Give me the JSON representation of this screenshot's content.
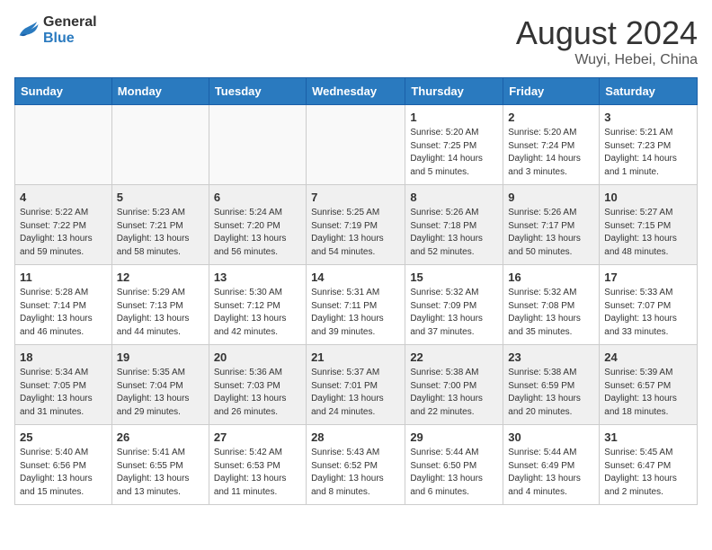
{
  "header": {
    "logo_general": "General",
    "logo_blue": "Blue",
    "month_year": "August 2024",
    "location": "Wuyi, Hebei, China"
  },
  "weekdays": [
    "Sunday",
    "Monday",
    "Tuesday",
    "Wednesday",
    "Thursday",
    "Friday",
    "Saturday"
  ],
  "weeks": [
    [
      {
        "num": "",
        "info": ""
      },
      {
        "num": "",
        "info": ""
      },
      {
        "num": "",
        "info": ""
      },
      {
        "num": "",
        "info": ""
      },
      {
        "num": "1",
        "info": "Sunrise: 5:20 AM\nSunset: 7:25 PM\nDaylight: 14 hours\nand 5 minutes."
      },
      {
        "num": "2",
        "info": "Sunrise: 5:20 AM\nSunset: 7:24 PM\nDaylight: 14 hours\nand 3 minutes."
      },
      {
        "num": "3",
        "info": "Sunrise: 5:21 AM\nSunset: 7:23 PM\nDaylight: 14 hours\nand 1 minute."
      }
    ],
    [
      {
        "num": "4",
        "info": "Sunrise: 5:22 AM\nSunset: 7:22 PM\nDaylight: 13 hours\nand 59 minutes."
      },
      {
        "num": "5",
        "info": "Sunrise: 5:23 AM\nSunset: 7:21 PM\nDaylight: 13 hours\nand 58 minutes."
      },
      {
        "num": "6",
        "info": "Sunrise: 5:24 AM\nSunset: 7:20 PM\nDaylight: 13 hours\nand 56 minutes."
      },
      {
        "num": "7",
        "info": "Sunrise: 5:25 AM\nSunset: 7:19 PM\nDaylight: 13 hours\nand 54 minutes."
      },
      {
        "num": "8",
        "info": "Sunrise: 5:26 AM\nSunset: 7:18 PM\nDaylight: 13 hours\nand 52 minutes."
      },
      {
        "num": "9",
        "info": "Sunrise: 5:26 AM\nSunset: 7:17 PM\nDaylight: 13 hours\nand 50 minutes."
      },
      {
        "num": "10",
        "info": "Sunrise: 5:27 AM\nSunset: 7:15 PM\nDaylight: 13 hours\nand 48 minutes."
      }
    ],
    [
      {
        "num": "11",
        "info": "Sunrise: 5:28 AM\nSunset: 7:14 PM\nDaylight: 13 hours\nand 46 minutes."
      },
      {
        "num": "12",
        "info": "Sunrise: 5:29 AM\nSunset: 7:13 PM\nDaylight: 13 hours\nand 44 minutes."
      },
      {
        "num": "13",
        "info": "Sunrise: 5:30 AM\nSunset: 7:12 PM\nDaylight: 13 hours\nand 42 minutes."
      },
      {
        "num": "14",
        "info": "Sunrise: 5:31 AM\nSunset: 7:11 PM\nDaylight: 13 hours\nand 39 minutes."
      },
      {
        "num": "15",
        "info": "Sunrise: 5:32 AM\nSunset: 7:09 PM\nDaylight: 13 hours\nand 37 minutes."
      },
      {
        "num": "16",
        "info": "Sunrise: 5:32 AM\nSunset: 7:08 PM\nDaylight: 13 hours\nand 35 minutes."
      },
      {
        "num": "17",
        "info": "Sunrise: 5:33 AM\nSunset: 7:07 PM\nDaylight: 13 hours\nand 33 minutes."
      }
    ],
    [
      {
        "num": "18",
        "info": "Sunrise: 5:34 AM\nSunset: 7:05 PM\nDaylight: 13 hours\nand 31 minutes."
      },
      {
        "num": "19",
        "info": "Sunrise: 5:35 AM\nSunset: 7:04 PM\nDaylight: 13 hours\nand 29 minutes."
      },
      {
        "num": "20",
        "info": "Sunrise: 5:36 AM\nSunset: 7:03 PM\nDaylight: 13 hours\nand 26 minutes."
      },
      {
        "num": "21",
        "info": "Sunrise: 5:37 AM\nSunset: 7:01 PM\nDaylight: 13 hours\nand 24 minutes."
      },
      {
        "num": "22",
        "info": "Sunrise: 5:38 AM\nSunset: 7:00 PM\nDaylight: 13 hours\nand 22 minutes."
      },
      {
        "num": "23",
        "info": "Sunrise: 5:38 AM\nSunset: 6:59 PM\nDaylight: 13 hours\nand 20 minutes."
      },
      {
        "num": "24",
        "info": "Sunrise: 5:39 AM\nSunset: 6:57 PM\nDaylight: 13 hours\nand 18 minutes."
      }
    ],
    [
      {
        "num": "25",
        "info": "Sunrise: 5:40 AM\nSunset: 6:56 PM\nDaylight: 13 hours\nand 15 minutes."
      },
      {
        "num": "26",
        "info": "Sunrise: 5:41 AM\nSunset: 6:55 PM\nDaylight: 13 hours\nand 13 minutes."
      },
      {
        "num": "27",
        "info": "Sunrise: 5:42 AM\nSunset: 6:53 PM\nDaylight: 13 hours\nand 11 minutes."
      },
      {
        "num": "28",
        "info": "Sunrise: 5:43 AM\nSunset: 6:52 PM\nDaylight: 13 hours\nand 8 minutes."
      },
      {
        "num": "29",
        "info": "Sunrise: 5:44 AM\nSunset: 6:50 PM\nDaylight: 13 hours\nand 6 minutes."
      },
      {
        "num": "30",
        "info": "Sunrise: 5:44 AM\nSunset: 6:49 PM\nDaylight: 13 hours\nand 4 minutes."
      },
      {
        "num": "31",
        "info": "Sunrise: 5:45 AM\nSunset: 6:47 PM\nDaylight: 13 hours\nand 2 minutes."
      }
    ]
  ]
}
